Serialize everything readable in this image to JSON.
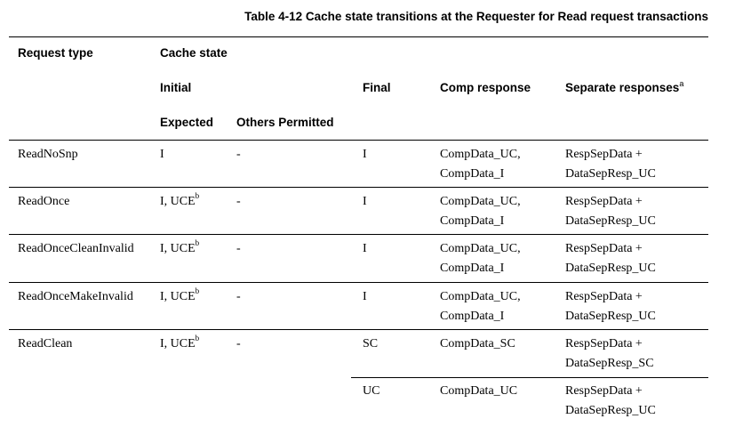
{
  "caption": "Table 4-12 Cache state transitions at the Requester for Read request transactions",
  "headers": {
    "request_type": "Request type",
    "cache_state": "Cache state",
    "initial": "Initial",
    "final": "Final",
    "comp_response": "Comp response",
    "separate_responses": "Separate responses",
    "separate_responses_note": "a",
    "expected": "Expected",
    "others_permitted": "Others Permitted"
  },
  "rows": [
    {
      "request_type": "ReadNoSnp",
      "expected": "I",
      "expected_note": "",
      "others": "-",
      "final": "I",
      "comp1": "CompData_UC,",
      "comp2": "CompData_I",
      "sep1": "RespSepData +",
      "sep2": "DataSepResp_UC"
    },
    {
      "request_type": "ReadOnce",
      "expected": "I, UCE",
      "expected_note": "b",
      "others": "-",
      "final": "I",
      "comp1": "CompData_UC,",
      "comp2": "CompData_I",
      "sep1": "RespSepData +",
      "sep2": "DataSepResp_UC"
    },
    {
      "request_type": "ReadOnceCleanInvalid",
      "expected": "I, UCE",
      "expected_note": "b",
      "others": "-",
      "final": "I",
      "comp1": "CompData_UC,",
      "comp2": "CompData_I",
      "sep1": "RespSepData +",
      "sep2": "DataSepResp_UC"
    },
    {
      "request_type": "ReadOnceMakeInvalid",
      "expected": "I, UCE",
      "expected_note": "b",
      "others": "-",
      "final": "I",
      "comp1": "CompData_UC,",
      "comp2": "CompData_I",
      "sep1": "RespSepData +",
      "sep2": "DataSepResp_UC"
    },
    {
      "request_type": "ReadClean",
      "expected": "I, UCE",
      "expected_note": "b",
      "others": "-",
      "final": "SC",
      "comp1": "CompData_SC",
      "comp2": "",
      "sep1": "RespSepData +",
      "sep2": "DataSepResp_SC"
    },
    {
      "request_type": "",
      "expected": "",
      "expected_note": "",
      "others": "",
      "final": "UC",
      "comp1": "CompData_UC",
      "comp2": "",
      "sep1": "RespSepData +",
      "sep2": "DataSepResp_UC"
    }
  ]
}
